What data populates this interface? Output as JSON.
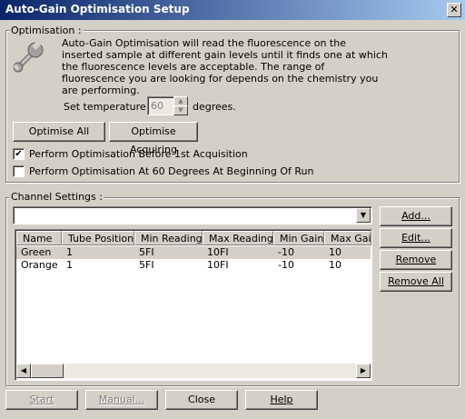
{
  "window": {
    "title": "Auto-Gain Optimisation Setup",
    "close_glyph": "✕"
  },
  "optimisation": {
    "group_label": "Optimisation :",
    "description": "Auto-Gain Optimisation will read the fluorescence on the inserted sample at different gain levels until it finds one at which the fluorescence levels are acceptable. The range of fluorescence you are looking for depends on the chemistry you are performing.",
    "set_temp_label": "Set temperature to",
    "temperature_value": "60",
    "degrees_label": "degrees.",
    "optimise_all_label": "Optimise All",
    "optimise_acquiring_label": "Optimise Acquiring",
    "checkbox1_label": "Perform Optimisation Before 1st Acquisition",
    "checkbox1_checked": true,
    "checkbox2_label": "Perform Optimisation At 60 Degrees At Beginning Of Run",
    "checkbox2_checked": false
  },
  "channel": {
    "group_label": "Channel Settings :",
    "dropdown_value": "",
    "columns": [
      "Name",
      "Tube Position",
      "Min Reading",
      "Max Reading",
      "Min Gain",
      "Max Gain"
    ],
    "rows": [
      [
        "Green",
        "1",
        "5FI",
        "10FI",
        "-10",
        "10"
      ],
      [
        "Orange",
        "1",
        "5FI",
        "10FI",
        "-10",
        "10"
      ]
    ],
    "add_label": "Add...",
    "edit_label": "Edit...",
    "remove_label": "Remove",
    "remove_all_label": "Remove All"
  },
  "footer": {
    "start_label": "Start",
    "manual_label": "Manual...",
    "close_label": "Close",
    "help_label": "Help"
  },
  "colors": {
    "titlebar_start": "#0a246a",
    "titlebar_end": "#a6caf0",
    "selection": "#d4d0c8"
  },
  "icons": [
    "wrench-icon",
    "close-icon",
    "dropdown-arrow-icon",
    "spin-up-icon",
    "spin-down-icon",
    "scroll-left-icon",
    "scroll-right-icon"
  ]
}
